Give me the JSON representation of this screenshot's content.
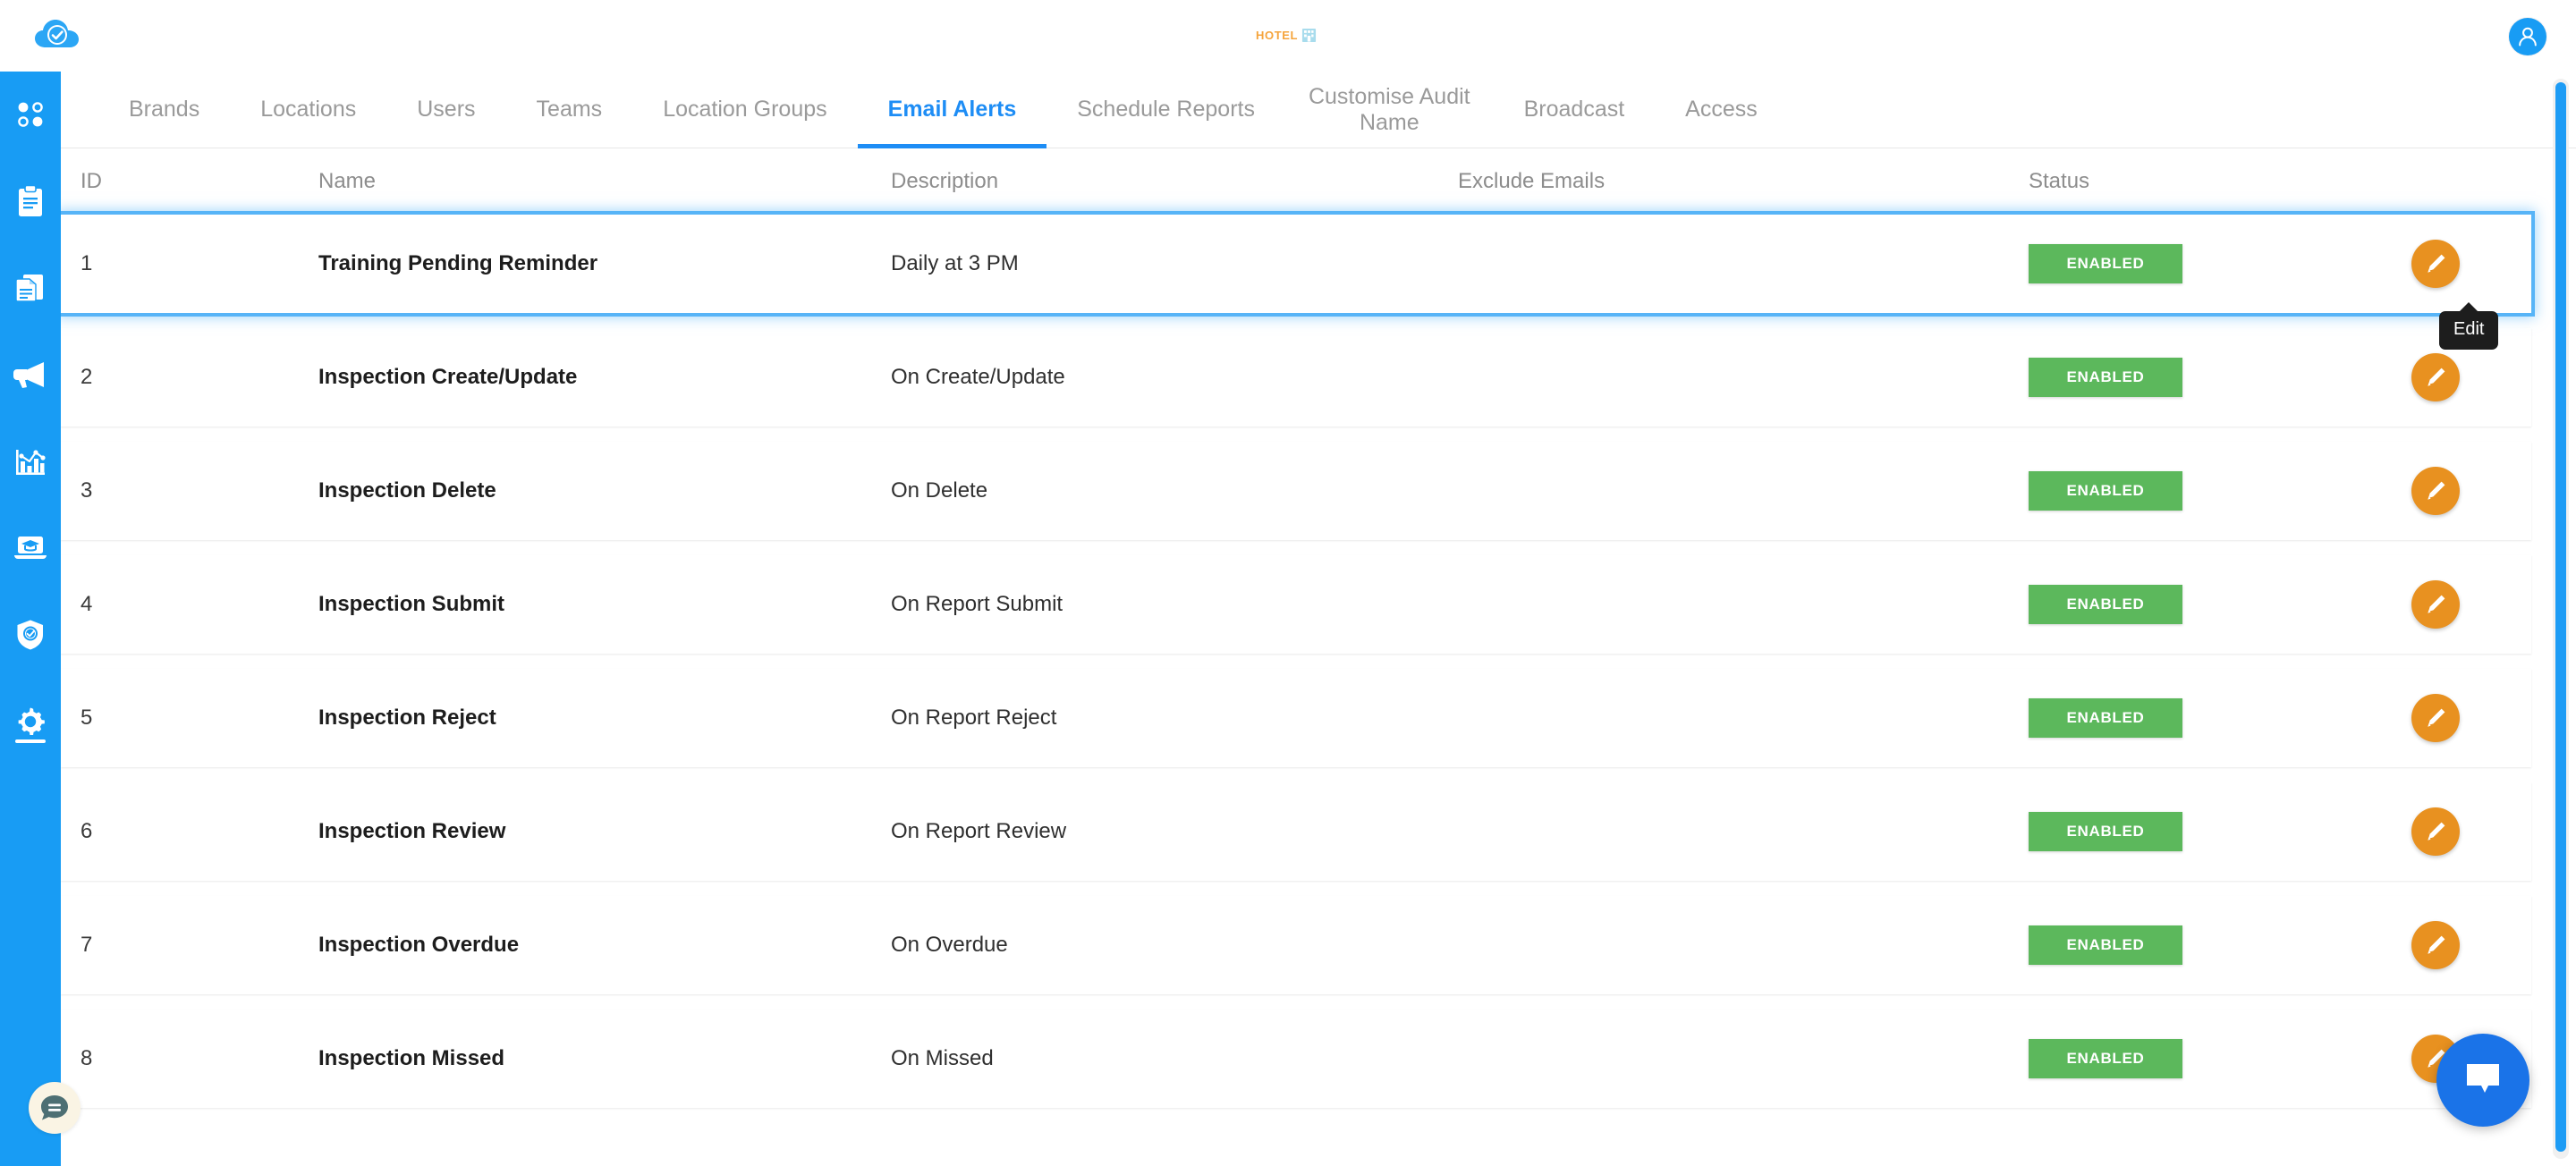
{
  "header": {
    "brand_logo_icon": "cloud-check-icon",
    "hotel_logo": {
      "text": "HOTEL",
      "icon": "hotel-building-icon",
      "color": "#f5a43c"
    },
    "avatar_icon": "user-avatar-icon"
  },
  "sidebar": {
    "background_color": "#189cf4",
    "items": [
      {
        "name": "dashboard",
        "icon": "grid-dots-icon",
        "active": false
      },
      {
        "name": "inspections",
        "icon": "clipboard-icon",
        "active": false
      },
      {
        "name": "reports",
        "icon": "documents-icon",
        "active": false
      },
      {
        "name": "broadcast",
        "icon": "megaphone-icon",
        "active": false
      },
      {
        "name": "analytics",
        "icon": "bar-chart-icon",
        "active": false
      },
      {
        "name": "elearning",
        "icon": "laptop-graduation-cap-icon",
        "active": false
      },
      {
        "name": "compliance",
        "icon": "shield-check-icon",
        "active": false
      },
      {
        "name": "settings",
        "icon": "gear-icon",
        "active": true
      }
    ]
  },
  "feedback": {
    "icon": "chat-bubble-lines-icon"
  },
  "chat": {
    "icon": "speech-bubble-icon",
    "color": "#1a73e8"
  },
  "tabs": [
    {
      "label": "Brands",
      "active": false
    },
    {
      "label": "Locations",
      "active": false
    },
    {
      "label": "Users",
      "active": false
    },
    {
      "label": "Teams",
      "active": false
    },
    {
      "label": "Location Groups",
      "active": false
    },
    {
      "label": "Email Alerts",
      "active": true
    },
    {
      "label": "Schedule Reports",
      "active": false
    },
    {
      "label": "Customise Audit\nName",
      "active": false
    },
    {
      "label": "Broadcast",
      "active": false
    },
    {
      "label": "Access",
      "active": false
    }
  ],
  "table": {
    "columns": [
      "ID",
      "Name",
      "Description",
      "Exclude Emails",
      "Status"
    ],
    "rows": [
      {
        "id": "1",
        "name": "Training Pending Reminder",
        "description": "Daily at 3 PM",
        "exclude_emails": "",
        "status": "ENABLED",
        "selected": true
      },
      {
        "id": "2",
        "name": "Inspection Create/Update",
        "description": "On Create/Update",
        "exclude_emails": "",
        "status": "ENABLED",
        "selected": false
      },
      {
        "id": "3",
        "name": "Inspection Delete",
        "description": "On Delete",
        "exclude_emails": "",
        "status": "ENABLED",
        "selected": false
      },
      {
        "id": "4",
        "name": "Inspection Submit",
        "description": "On Report Submit",
        "exclude_emails": "",
        "status": "ENABLED",
        "selected": false
      },
      {
        "id": "5",
        "name": "Inspection Reject",
        "description": "On Report Reject",
        "exclude_emails": "",
        "status": "ENABLED",
        "selected": false
      },
      {
        "id": "6",
        "name": "Inspection Review",
        "description": "On Report Review",
        "exclude_emails": "",
        "status": "ENABLED",
        "selected": false
      },
      {
        "id": "7",
        "name": "Inspection Overdue",
        "description": "On Overdue",
        "exclude_emails": "",
        "status": "ENABLED",
        "selected": false
      },
      {
        "id": "8",
        "name": "Inspection Missed",
        "description": "On Missed",
        "exclude_emails": "",
        "status": "ENABLED",
        "selected": false
      }
    ],
    "edit_button_icon": "pencil-icon",
    "status_badge_color": "#5cb85c",
    "edit_button_color": "#e89120"
  },
  "tooltip": {
    "text": "Edit"
  },
  "scrollbar": {
    "color": "#1e9cf5"
  }
}
